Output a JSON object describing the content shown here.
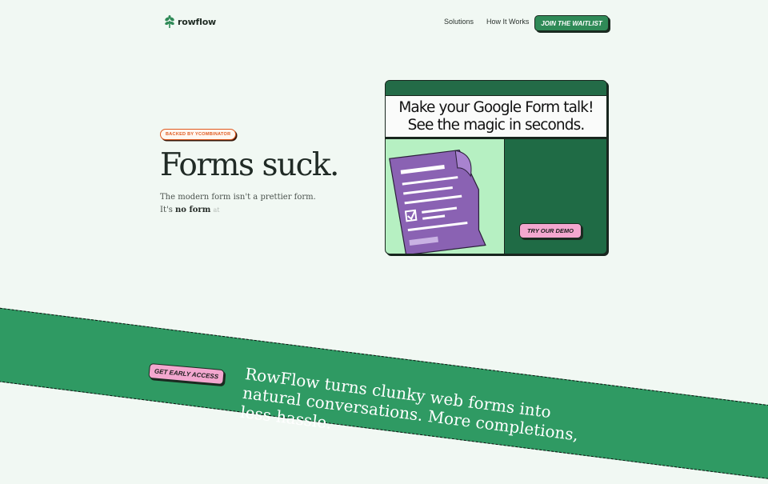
{
  "header": {
    "brand": "rowflow",
    "nav": [
      "Solutions",
      "How It Works"
    ],
    "cta": "JOIN THE WAITLIST"
  },
  "hero": {
    "badge": "BACKED BY YCOMBINATOR",
    "title": "Forms suck.",
    "sub_line1": "The modern form isn't a prettier form.",
    "sub_prefix": "It's ",
    "sub_bold": "no form",
    "sub_ghost": "at"
  },
  "demo_card": {
    "line1": "Make your Google Form talk!",
    "line2": "See the magic in seconds.",
    "button": "TRY OUR DEMO"
  },
  "banner": {
    "button": "GET EARLY ACCESS",
    "text": "RowFlow turns clunky web forms into natural conversations. More completions, less hassle."
  },
  "colors": {
    "brand_green": "#2f8a57",
    "dark_green": "#226d49",
    "mint": "#b6f0c2",
    "pink": "#f3a7cf",
    "badge_orange": "#e05a1f",
    "background": "#f1f8f3"
  },
  "icons": [
    "sprout-logo-icon",
    "form-document-icon"
  ]
}
